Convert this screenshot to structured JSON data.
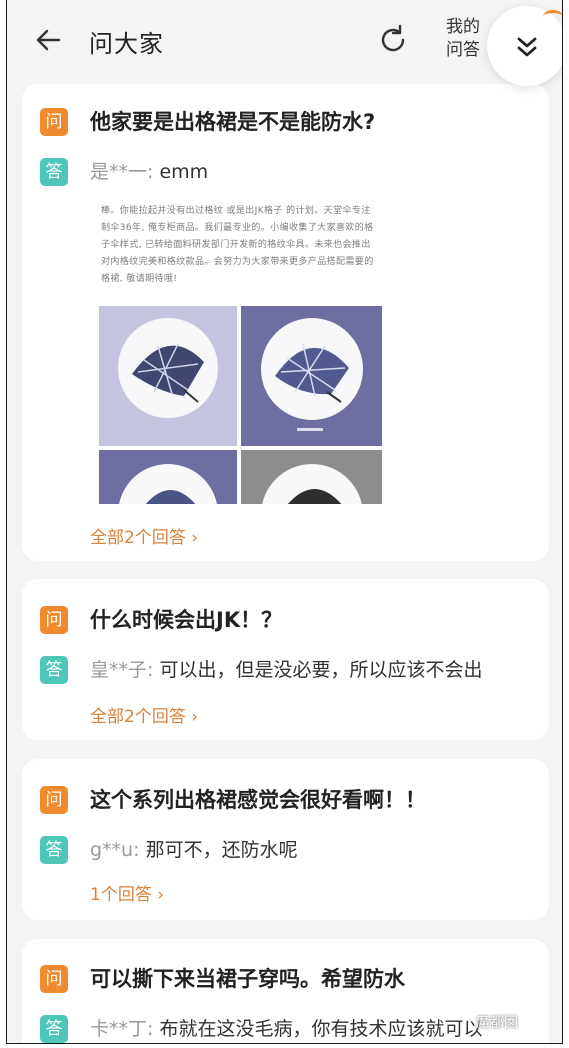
{
  "header": {
    "title": "问大家",
    "my_answers": "我的\n问答"
  },
  "badges": {
    "question": "问",
    "answer": "答"
  },
  "questions": [
    {
      "question": "他家要是出格裙是不是能防水?",
      "answer_user": "是**一:",
      "answer_text": "emm",
      "more": "全部2个回答",
      "image_caption": "棒。你能拉起并没有出过格纹 或是出JK格子 的计划。天堂伞专注制伞36年, 俺专柜商品。我们最专业的。小编收集了大家喜欢的格子伞样式, 已转给面料研发部门开发新的格纹伞具。未来也会推出对内格纹完美和格纹款品。会努力为大家带来更多产品搭配需要的格裙, 敬请期待哦!"
    },
    {
      "question": "什么时候会出JK！？",
      "answer_user": "皇**子:",
      "answer_text": "可以出，但是没必要，所以应该不会出",
      "more": "全部2个回答"
    },
    {
      "question": "这个系列出格裙感觉会很好看啊！！",
      "answer_user": "g**u:",
      "answer_text": "那可不，还防水呢",
      "more": "1个回答"
    },
    {
      "question": "可以撕下来当裙子穿吗。希望防水",
      "answer_user": "卡**丁:",
      "answer_text": "布就在这没毛病，你有技术应该就可以"
    }
  ],
  "watermark": "魔都囡",
  "colors": {
    "question_badge": "#f08a2e",
    "answer_badge": "#4fc7b8",
    "link": "#d9823a",
    "background": "#f4f4f5"
  }
}
